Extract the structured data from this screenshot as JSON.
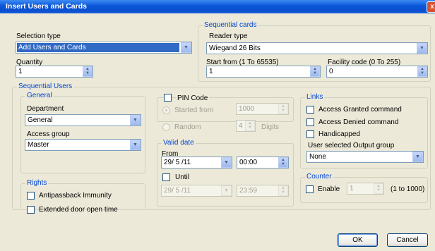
{
  "window": {
    "title": "Insert Users and Cards",
    "close_glyph": "x"
  },
  "selection": {
    "label": "Selection type",
    "value": "Add Users and Cards"
  },
  "quantity": {
    "label": "Quantity",
    "value": "1"
  },
  "sequential_cards": {
    "title": "Sequential cards",
    "reader_label": "Reader type",
    "reader_value": "Wiegand 26 Bits",
    "start_label": "Start from (1 To 65535)",
    "start_value": "1",
    "facility_label": "Facility code (0 To 255)",
    "facility_value": "0"
  },
  "sequential_users": {
    "title": "Sequential Users",
    "general": {
      "title": "General",
      "department_label": "Department",
      "department_value": "General",
      "access_group_label": "Access group",
      "access_group_value": "Master"
    },
    "rights": {
      "title": "Rights",
      "antipassback": "Antipassback Immunity",
      "extended": "Extended door open time"
    },
    "pin": {
      "label": "PIN Code",
      "started_from": "Started from",
      "started_value": "1000",
      "random": "Random",
      "digits_value": "4",
      "digits_label": "Digits"
    },
    "valid": {
      "title": "Valid date",
      "from_label": "From",
      "from_date": "29/ 5 /11",
      "from_time": "00:00",
      "until_label": "Until",
      "until_date": "29/ 5 /11",
      "until_time": "23:59"
    },
    "links": {
      "title": "Links",
      "granted": "Access Granted command",
      "denied": "Access Denied command",
      "handicapped": "Handicapped",
      "output_label": "User selected Output group",
      "output_value": "None"
    },
    "counter": {
      "title": "Counter",
      "enable": "Enable",
      "value": "1",
      "range": "(1 to 1000)"
    }
  },
  "buttons": {
    "ok": "OK",
    "cancel": "Cancel"
  },
  "colors": {
    "titlebar": "#0a55d8",
    "group_title": "#0046d5",
    "selection_highlight": "#316ac5",
    "window_bg": "#ece9d8"
  }
}
